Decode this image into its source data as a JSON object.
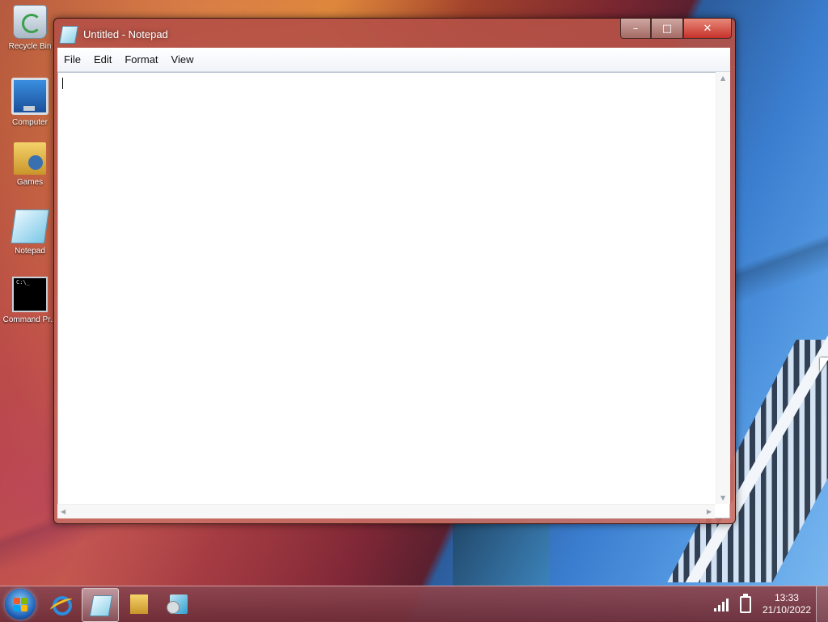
{
  "desktop": {
    "icons": [
      {
        "label": "Recycle Bin"
      },
      {
        "label": "Computer"
      },
      {
        "label": "Games"
      },
      {
        "label": "Notepad"
      },
      {
        "label": "Command Pr..."
      }
    ]
  },
  "window": {
    "title": "Untitled - Notepad",
    "controls": {
      "minimize": "–",
      "maximize": "□",
      "close": "✕"
    },
    "menu": [
      "File",
      "Edit",
      "Format",
      "View"
    ],
    "content": ""
  },
  "taskbar": {
    "items": [
      "internet-explorer-icon",
      "notepad-icon",
      "folder-icon",
      "media-player-icon"
    ],
    "clock": {
      "time": "13:33",
      "date": "21/10/2022"
    }
  }
}
